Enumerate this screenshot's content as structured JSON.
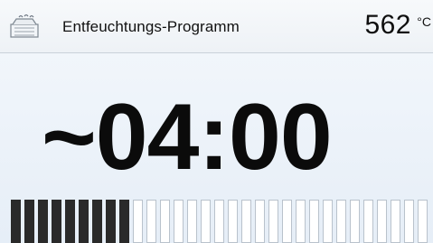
{
  "header": {
    "icon": "dehumidify-program-icon",
    "title": "Entfeuchtungs-Programm",
    "temperature": "562",
    "temperature_unit": "°C"
  },
  "main": {
    "remaining_time": "~04:00"
  },
  "progress": {
    "filled_fraction": 0.29
  },
  "colors": {
    "segment_filled": "#2a2a2a",
    "segment_empty": "#ffffff",
    "background": "#eef3f8"
  }
}
